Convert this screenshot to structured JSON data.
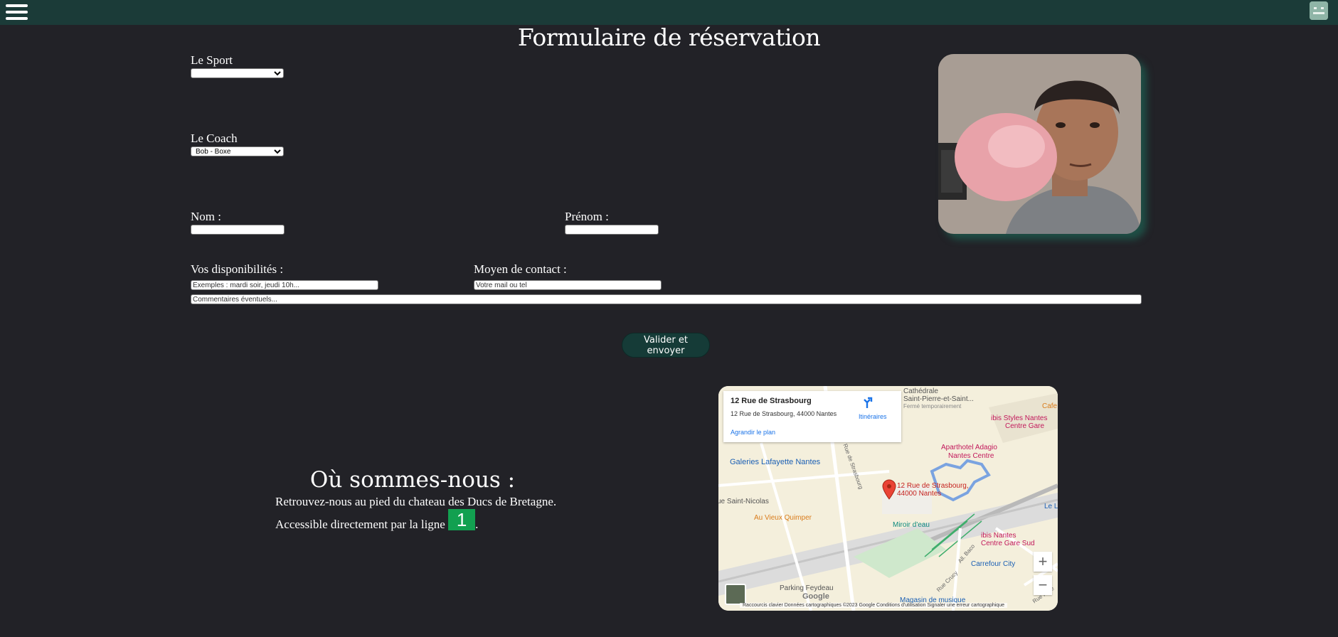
{
  "form": {
    "title": "Formulaire de réservation",
    "sport_label": "Le Sport",
    "sport_selected": "",
    "coach_label": "Le Coach",
    "coach_selected": "Bob - Boxe",
    "nom_label": "Nom :",
    "prenom_label": "Prénom :",
    "dispo_label": "Vos disponibilités :",
    "dispo_placeholder": "Exemples : mardi soir, jeudi 10h...",
    "contact_label": "Moyen de contact :",
    "contact_placeholder": "Votre mail ou tel",
    "comments_placeholder": "Commentaires éventuels...",
    "submit_label": "Valider et envoyer"
  },
  "location": {
    "title": "Où sommes-nous :",
    "line1": "Retrouvez-nous au pied du chateau des Ducs de Bretagne.",
    "line2_prefix": "Accessible directement par la ligne",
    "line_number": "1",
    "line2_suffix": "."
  },
  "map": {
    "place_name": "12 Rue de Strasbourg",
    "place_address": "12 Rue de Strasbourg, 44000 Nantes",
    "directions_label": "Itinéraires",
    "enlarge_label": "Agrandir le plan",
    "marker_label_1": "12 Rue de Strasbourg,",
    "marker_label_2": "44000 Nantes",
    "labels": {
      "cathedrale_1": "Cathédrale",
      "cathedrale_2": "Saint-Pierre-et-Saint...",
      "cathedrale_3": "Fermé temporairement",
      "cafe": "Cafe",
      "ibis_styles_1": "ibis Styles Nantes",
      "ibis_styles_2": "Centre Gare",
      "adagio_1": "Aparthotel Adagio",
      "adagio_2": "Nantes Centre",
      "galeries": "Galeries Lafayette Nantes",
      "saint_nicolas": "ue Saint-Nicolas",
      "quimper": "Au Vieux Quimper",
      "miroir": "Miroir d'eau",
      "ibis_sud_1": "ibis Nantes",
      "ibis_sud_2": "Centre Gare Sud",
      "le_li": "Le Li",
      "carrefour": "Carrefour City",
      "feydeau": "Parking Feydeau",
      "magasin": "Magasin de musique",
      "rue_strasbourg": "Rue de Strasbourg",
      "all_baco": "All. Baco",
      "rue_crucy": "Rue Crucy",
      "rue_pelle": "Rue Pelle"
    },
    "zoom_in": "+",
    "zoom_out": "−",
    "google": "Google",
    "footer": "Raccourcis clavier    Données cartographiques ©2023 Google    Conditions d'utilisation    Signaler une erreur cartographique"
  },
  "icons": {
    "menu": "hamburger-icon",
    "user": "avatar-icon",
    "directions": "directions-arrow-icon",
    "marker": "map-pin-icon"
  },
  "colors": {
    "background": "#222227",
    "topbar": "#1b3b38",
    "button": "#153b37",
    "tram_line": "#12a050",
    "photo_shadow": "#1f4f46"
  }
}
